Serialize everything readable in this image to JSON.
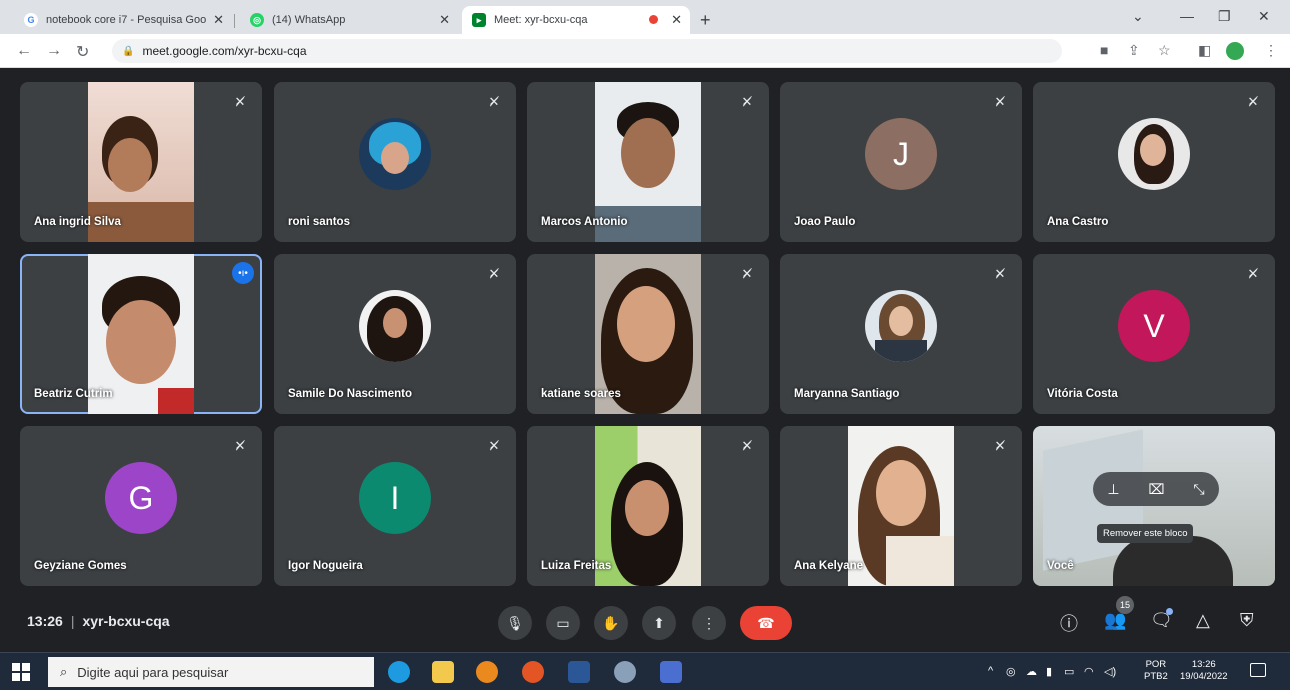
{
  "browser": {
    "tabs": [
      {
        "title": "notebook core i7 - Pesquisa Goo",
        "icon": "google-icon"
      },
      {
        "title": "(14) WhatsApp",
        "icon": "whatsapp-icon"
      },
      {
        "title": "Meet: xyr-bcxu-cqa",
        "icon": "meet-icon"
      }
    ],
    "url": "meet.google.com/xyr-bcxu-cqa"
  },
  "participants": [
    {
      "name": "Ana ingrid Silva",
      "type": "video"
    },
    {
      "name": "roni santos",
      "type": "photo"
    },
    {
      "name": "Marcos Antonio",
      "type": "video"
    },
    {
      "name": "Joao Paulo",
      "type": "initial",
      "initial": "J",
      "color": "#8d6e63"
    },
    {
      "name": "Ana Castro",
      "type": "photo"
    },
    {
      "name": "Beatriz Cutrim",
      "type": "video",
      "speaking": true
    },
    {
      "name": "Samile Do Nascimento",
      "type": "photo"
    },
    {
      "name": "katiane soares",
      "type": "video"
    },
    {
      "name": "Maryanna Santiago",
      "type": "photo"
    },
    {
      "name": "Vitória Costa",
      "type": "initial",
      "initial": "V",
      "color": "#c2185b"
    },
    {
      "name": "Geyziane Gomes",
      "type": "initial",
      "initial": "G",
      "color": "#9c45c9"
    },
    {
      "name": "Igor Nogueira",
      "type": "initial",
      "initial": "I",
      "color": "#0b8a6f"
    },
    {
      "name": "Luiza Freitas",
      "type": "video"
    },
    {
      "name": "Ana Kelyane",
      "type": "video"
    },
    {
      "name": "Você",
      "type": "self"
    }
  ],
  "self_tile": {
    "tooltip": "Remover este bloco"
  },
  "meeting": {
    "time": "13:26",
    "code": "xyr-bcxu-cqa",
    "participant_count": "15"
  },
  "taskbar": {
    "search_placeholder": "Digite aqui para pesquisar",
    "lang_line1": "POR",
    "lang_line2": "PTB2",
    "time": "13:26",
    "date": "19/04/2022"
  }
}
